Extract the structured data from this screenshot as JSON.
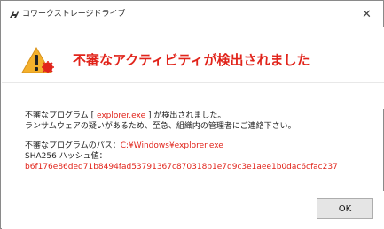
{
  "window": {
    "title": "コワークストレージドライブ",
    "close_glyph": "✕",
    "app_icon": "tools-icon"
  },
  "header": {
    "heading": "不審なアクティビティが検出されました",
    "icon": "warning-icon",
    "accent_color": "#e1241b"
  },
  "message": {
    "line1_prefix": "不審なプログラム [ ",
    "program_name": "explorer.exe",
    "line1_suffix": " ] が検出されました。",
    "line2": "ランサムウェアの疑いがあるため、至急、組織内の管理者にご連絡下さい。",
    "path_label": "不審なプログラムのパス：",
    "path_value": "C:¥Windows¥explorer.exe",
    "hash_label": "SHA256 ハッシュ値：",
    "hash_value": "b6f176e86ded71b8494fad53791367c870318b1e7d9c3e1aee1b0dac6cfac237"
  },
  "buttons": {
    "ok_label": "OK"
  }
}
